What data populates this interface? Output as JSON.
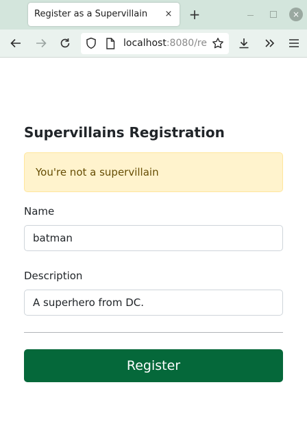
{
  "browser": {
    "tab_title": "Register as a Supervillain",
    "tab_close_glyph": "×",
    "new_tab_glyph": "+",
    "window_close_glyph": "×",
    "url_host": "localhost",
    "url_rest": ":8080/re",
    "icons": [
      "back-arrow-icon",
      "forward-arrow-icon",
      "reload-icon",
      "shield-icon",
      "page-icon",
      "star-icon",
      "download-icon",
      "overflow-chevrons-icon",
      "hamburger-menu-icon"
    ]
  },
  "page": {
    "title": "Supervillains Registration",
    "alert": {
      "text": "You're not a supervillain",
      "background": "#fff3cd",
      "text_color": "#664d03"
    },
    "form": {
      "name_label": "Name",
      "name_value": "batman",
      "description_label": "Description",
      "description_value": "A superhero from DC.",
      "submit_label": "Register",
      "submit_color": "#05683a"
    }
  }
}
